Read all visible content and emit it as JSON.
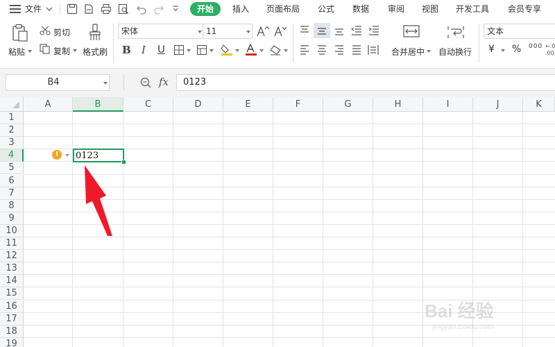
{
  "menu": {
    "file_label": "文件",
    "tabs": [
      "开始",
      "插入",
      "页面布局",
      "公式",
      "数据",
      "审阅",
      "视图",
      "开发工具",
      "会员专享"
    ]
  },
  "ribbon": {
    "paste_label": "粘贴",
    "cut_label": "剪切",
    "copy_label": "复制",
    "format_painter_label": "格式刷",
    "font_name": "宋体",
    "font_size": "11",
    "merge_center_label": "合并居中",
    "wrap_text_label": "自动换行",
    "number_format": "文本",
    "currency_symbol": "¥",
    "percent_symbol": "%",
    "thousands_symbol": "000"
  },
  "formula_bar": {
    "cell_ref": "B4",
    "fx_label": "fx",
    "value": "0123"
  },
  "sheet": {
    "columns": [
      "A",
      "B",
      "C",
      "D",
      "E",
      "F",
      "G",
      "H",
      "I",
      "J",
      "K"
    ],
    "rows": [
      "1",
      "2",
      "3",
      "4",
      "5",
      "6",
      "7",
      "8",
      "9",
      "10",
      "11",
      "12",
      "13",
      "14",
      "15",
      "16",
      "17",
      "18",
      "19"
    ],
    "selected_cell": "B4",
    "selected_cell_value": "0123",
    "error_indicator": "!"
  },
  "watermark": {
    "brand": "Bai 经验",
    "url": "jingyan.baidu.com"
  },
  "colors": {
    "accent": "#2eae62",
    "selection": "#1e9b5a",
    "arrow": "#f0192a",
    "warning": "#f5a623"
  }
}
